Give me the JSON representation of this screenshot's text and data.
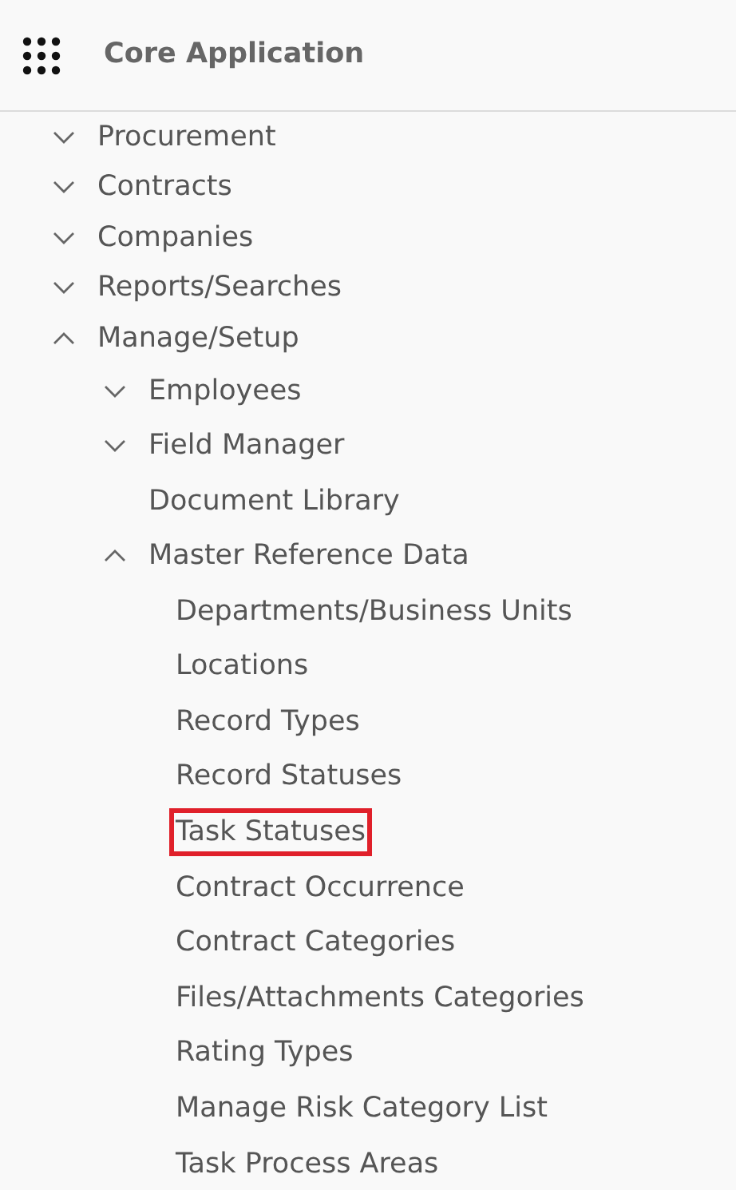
{
  "header": {
    "title": "Core Application"
  },
  "nav": [
    {
      "label": "Procurement",
      "kind": "group",
      "expanded": false
    },
    {
      "label": "Contracts",
      "kind": "group",
      "expanded": false
    },
    {
      "label": "Companies",
      "kind": "group",
      "expanded": false
    },
    {
      "label": "Reports/Searches",
      "kind": "group",
      "expanded": false
    },
    {
      "label": "Manage/Setup",
      "kind": "group",
      "expanded": true,
      "children": [
        {
          "label": "Employees",
          "kind": "group",
          "expanded": false
        },
        {
          "label": "Field Manager",
          "kind": "group",
          "expanded": false
        },
        {
          "label": "Document Library",
          "kind": "link"
        },
        {
          "label": "Master Reference Data",
          "kind": "group",
          "expanded": true,
          "children": [
            {
              "label": "Departments/Business Units",
              "kind": "link",
              "highlighted": false
            },
            {
              "label": "Locations",
              "kind": "link",
              "highlighted": false
            },
            {
              "label": "Record Types",
              "kind": "link",
              "highlighted": false
            },
            {
              "label": "Record Statuses",
              "kind": "link",
              "highlighted": false
            },
            {
              "label": "Task Statuses",
              "kind": "link",
              "highlighted": true
            },
            {
              "label": "Contract Occurrence",
              "kind": "link",
              "highlighted": false
            },
            {
              "label": "Contract Categories",
              "kind": "link",
              "highlighted": false
            },
            {
              "label": "Files/Attachments Categories",
              "kind": "link",
              "highlighted": false
            },
            {
              "label": "Rating Types",
              "kind": "link",
              "highlighted": false
            },
            {
              "label": "Manage Risk Category List",
              "kind": "link",
              "highlighted": false
            },
            {
              "label": "Task Process Areas",
              "kind": "link",
              "highlighted": false
            }
          ]
        }
      ]
    }
  ]
}
